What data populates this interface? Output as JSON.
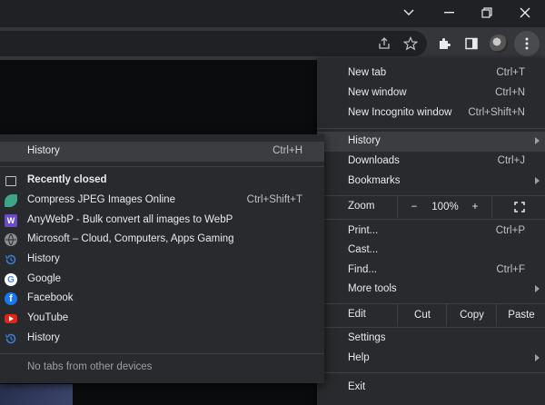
{
  "window": {
    "controls": [
      "chevron-down",
      "minimize",
      "restore",
      "close"
    ]
  },
  "toolbar": {
    "icons": [
      "share-icon",
      "bookmark-star-icon",
      "extensions-icon",
      "side-panel-icon",
      "profile-avatar",
      "more-icon"
    ]
  },
  "menu": {
    "new_tab": {
      "label": "New tab",
      "shortcut": "Ctrl+T"
    },
    "new_window": {
      "label": "New window",
      "shortcut": "Ctrl+N"
    },
    "new_incognito": {
      "label": "New Incognito window",
      "shortcut": "Ctrl+Shift+N"
    },
    "history": {
      "label": "History"
    },
    "downloads": {
      "label": "Downloads",
      "shortcut": "Ctrl+J"
    },
    "bookmarks": {
      "label": "Bookmarks"
    },
    "zoom": {
      "label": "Zoom",
      "minus": "−",
      "value": "100%",
      "plus": "+"
    },
    "print": {
      "label": "Print...",
      "shortcut": "Ctrl+P"
    },
    "cast": {
      "label": "Cast..."
    },
    "find": {
      "label": "Find...",
      "shortcut": "Ctrl+F"
    },
    "more_tools": {
      "label": "More tools"
    },
    "edit": {
      "label": "Edit",
      "cut": "Cut",
      "copy": "Copy",
      "paste": "Paste"
    },
    "settings": {
      "label": "Settings"
    },
    "help": {
      "label": "Help"
    },
    "exit": {
      "label": "Exit"
    }
  },
  "history_submenu": {
    "history": {
      "label": "History",
      "shortcut": "Ctrl+H"
    },
    "recently_closed": {
      "label": "Recently closed"
    },
    "items": [
      {
        "label": "Compress JPEG Images Online",
        "shortcut": "Ctrl+Shift+T",
        "icon": "leaf",
        "color": "#3fa58a"
      },
      {
        "label": "AnyWebP - Bulk convert all images to WebP",
        "shortcut": "",
        "icon": "W",
        "color": "#6a4cc9"
      },
      {
        "label": "Microsoft – Cloud, Computers, Apps  Gaming",
        "shortcut": "",
        "icon": "globe",
        "color": "#8a8d91"
      },
      {
        "label": "History",
        "shortcut": "",
        "icon": "history",
        "color": "#3b7fd6"
      },
      {
        "label": "Google",
        "shortcut": "",
        "icon": "G",
        "color": "#ffffff"
      },
      {
        "label": "Facebook",
        "shortcut": "",
        "icon": "f",
        "color": "#1877f2"
      },
      {
        "label": "YouTube",
        "shortcut": "",
        "icon": "play",
        "color": "#e62117"
      },
      {
        "label": "History",
        "shortcut": "",
        "icon": "history",
        "color": "#3b7fd6"
      }
    ],
    "no_tabs": "No tabs from other devices"
  }
}
